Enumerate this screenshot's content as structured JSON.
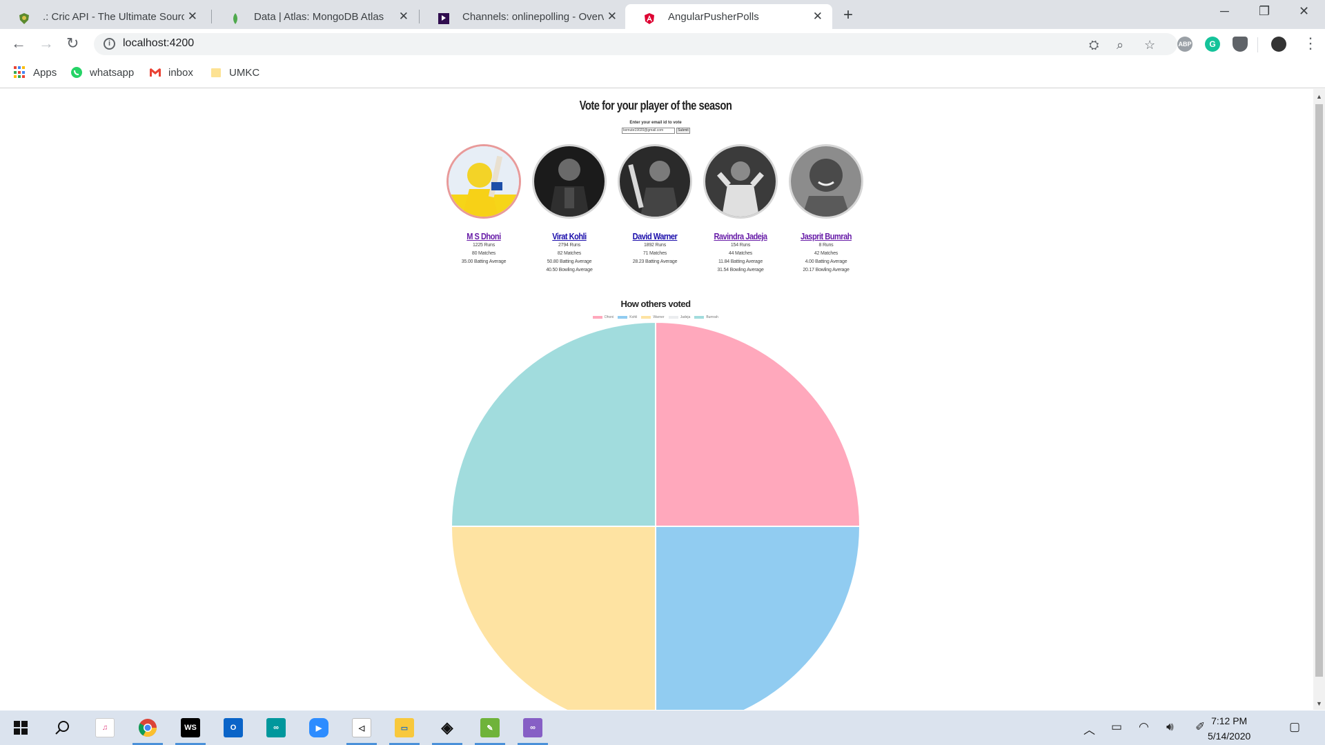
{
  "browser": {
    "tabs": [
      {
        "title": ".: Cric API - The Ultimate Source f",
        "icon": "shield-favicon-icon",
        "active": false
      },
      {
        "title": "Data | Atlas: MongoDB Atlas",
        "icon": "mongodb-leaf-icon",
        "active": false
      },
      {
        "title": "Channels: onlinepolling - Overvie",
        "icon": "pusher-favicon-icon",
        "active": false
      },
      {
        "title": "AngularPusherPolls",
        "icon": "angular-favicon-icon",
        "active": true
      }
    ],
    "url": "localhost:4200",
    "bookmarks": [
      {
        "label": "Apps",
        "icon": "apps-grid-icon"
      },
      {
        "label": "whatsapp",
        "icon": "whatsapp-icon"
      },
      {
        "label": "inbox",
        "icon": "gmail-icon"
      },
      {
        "label": "UMKC",
        "icon": "folder-icon"
      }
    ],
    "extensions": [
      "ABP",
      "G"
    ]
  },
  "page": {
    "title": "Vote for your player of the season",
    "email_label": "Enter your email id to vote",
    "email_value": "kemute19020@gmail.com",
    "submit_label": "Submit",
    "players": [
      {
        "name": "M S Dhoni",
        "stats": [
          "1225 Runs",
          "80 Matches",
          "35.00 Batting Average"
        ],
        "jersey": "#f7d117",
        "selected": true,
        "visited": true
      },
      {
        "name": "Virat Kohli",
        "stats": [
          "2794 Runs",
          "82 Matches",
          "50.80 Batting Average",
          "40.50 Bowling Average"
        ],
        "jersey": "#2a2a2a",
        "selected": false,
        "visited": false
      },
      {
        "name": "David Warner",
        "stats": [
          "1892 Runs",
          "71 Matches",
          "28.23 Batting Average"
        ],
        "jersey": "#3a3a3a",
        "selected": false,
        "visited": false
      },
      {
        "name": "Ravindra Jadeja",
        "stats": [
          "154 Runs",
          "44 Matches",
          "11.84 Batting Average",
          "31.54 Bowling Average"
        ],
        "jersey": "#d8d8d8",
        "selected": false,
        "visited": true
      },
      {
        "name": "Jasprit Bumrah",
        "stats": [
          "8 Runs",
          "42 Matches",
          "4.00 Batting Average",
          "20.17 Bowling Average"
        ],
        "jersey": "#5a5a5a",
        "selected": false,
        "visited": true
      }
    ],
    "chart_title": "How others voted"
  },
  "chart_data": {
    "type": "pie",
    "title": "How others voted",
    "categories": [
      "Dhoni",
      "Kohli",
      "Warner",
      "Jadeja",
      "Bumrah"
    ],
    "values": [
      1,
      1,
      1,
      0,
      1
    ],
    "colors": [
      "#ffa8bc",
      "#91ccf1",
      "#fee3a2",
      "#ebedef",
      "#a1dcdd"
    ],
    "legend_position": "top"
  },
  "taskbar": {
    "apps": [
      "windows-start-icon",
      "search-icon",
      "itunes-icon",
      "chrome-icon",
      "webstorm-icon",
      "outlook-icon",
      "arduino-icon",
      "zoom-icon",
      "sourcetree-icon",
      "file-explorer-icon",
      "unity-icon",
      "greenfoot-icon",
      "visual-studio-icon"
    ],
    "time": "7:12 PM",
    "date": "5/14/2020"
  }
}
